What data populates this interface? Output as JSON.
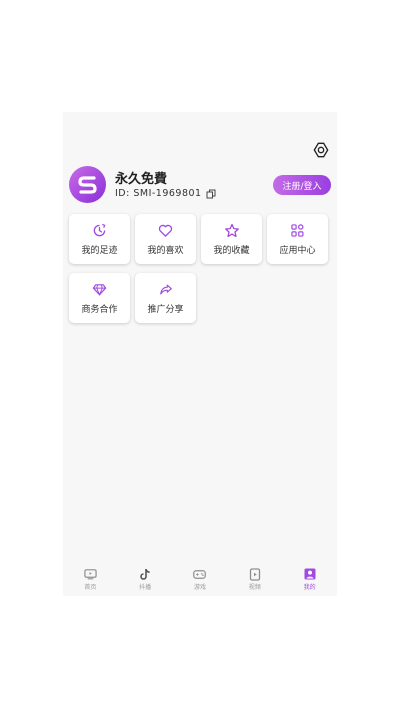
{
  "colors": {
    "accent": "#a14ae0",
    "background": "#f7f7f8",
    "tile": "#ffffff"
  },
  "header": {
    "settings_icon": "gear-icon"
  },
  "profile": {
    "nickname": "永久免費",
    "uid": "ID: SMI-1969801",
    "copy_icon": "copy-icon",
    "login_label": "注册/登入"
  },
  "menu": [
    {
      "label": "我的足迹",
      "icon": "history-icon"
    },
    {
      "label": "我的喜欢",
      "icon": "heart-icon"
    },
    {
      "label": "我的收藏",
      "icon": "star-icon"
    },
    {
      "label": "应用中心",
      "icon": "apps-icon"
    },
    {
      "label": "商务合作",
      "icon": "diamond-icon"
    },
    {
      "label": "推广分享",
      "icon": "share-icon"
    }
  ],
  "tabbar": {
    "items": [
      {
        "label": "首页",
        "icon": "tv-icon",
        "active": false
      },
      {
        "label": "抖播",
        "icon": "tiktok-icon",
        "active": false
      },
      {
        "label": "游戏",
        "icon": "gamepad-icon",
        "active": false
      },
      {
        "label": "视频",
        "icon": "video-icon",
        "active": false
      },
      {
        "label": "我的",
        "icon": "user-icon",
        "active": true
      }
    ]
  }
}
